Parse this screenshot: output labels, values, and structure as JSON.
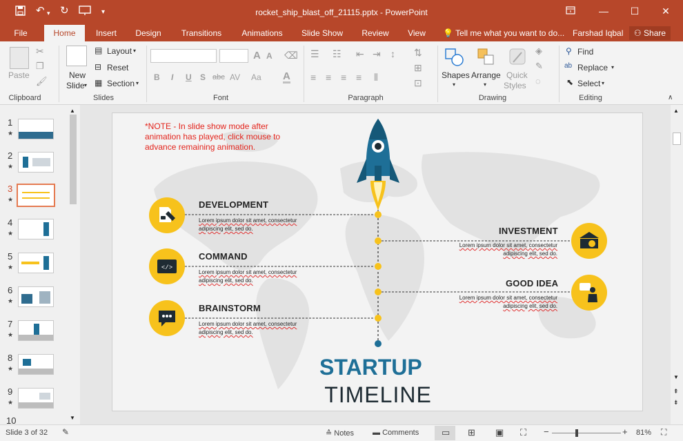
{
  "app": {
    "title": "rocket_ship_blast_off_21115.pptx - PowerPoint",
    "window_buttons": [
      "ribbon-display",
      "minimize",
      "maximize",
      "close"
    ]
  },
  "tabs": [
    {
      "label": "File"
    },
    {
      "label": "Home",
      "active": true
    },
    {
      "label": "Insert"
    },
    {
      "label": "Design"
    },
    {
      "label": "Transitions"
    },
    {
      "label": "Animations"
    },
    {
      "label": "Slide Show"
    },
    {
      "label": "Review"
    },
    {
      "label": "View"
    }
  ],
  "tell_me": "Tell me what you want to do...",
  "user": "Farshad Iqbal",
  "share": "Share",
  "ribbon": {
    "clipboard": {
      "paste": "Paste",
      "label": "Clipboard"
    },
    "slides": {
      "new_slide_1": "New",
      "new_slide_2": "Slide",
      "layout": "Layout",
      "reset": "Reset",
      "section": "Section",
      "label": "Slides"
    },
    "font": {
      "label": "Font",
      "bold": "B",
      "italic": "I",
      "underline": "U",
      "strike": "S",
      "strike2": "abc",
      "spacing": "AV",
      "case": "Aa",
      "grow": "A",
      "shrink": "A"
    },
    "paragraph": {
      "label": "Paragraph"
    },
    "drawing": {
      "shapes": "Shapes",
      "arrange": "Arrange",
      "quick_1": "Quick",
      "quick_2": "Styles",
      "label": "Drawing"
    },
    "editing": {
      "find": "Find",
      "replace": "Replace",
      "select": "Select",
      "label": "Editing"
    }
  },
  "thumbnails": [
    {
      "num": "1"
    },
    {
      "num": "2"
    },
    {
      "num": "3",
      "current": true
    },
    {
      "num": "4"
    },
    {
      "num": "5"
    },
    {
      "num": "6"
    },
    {
      "num": "7"
    },
    {
      "num": "8"
    },
    {
      "num": "9"
    },
    {
      "num": "10"
    }
  ],
  "slide": {
    "note": "*NOTE - In slide show mode after animation has played, click mouse to advance remaining animation.",
    "items": [
      {
        "title": "DEVELOPMENT",
        "desc1": "Lorem ipsum dolor sit amet, consectetur",
        "desc2": "adipiscing elit, sed do."
      },
      {
        "title": "COMMAND",
        "desc1": "Lorem ipsum dolor sit amet, consectetur",
        "desc2": "adipiscing elit, sed do."
      },
      {
        "title": "BRAINSTORM",
        "desc1": "Lorem ipsum dolor sit amet, consectetur",
        "desc2": "adipiscing elit, sed do."
      },
      {
        "title": "INVESTMENT",
        "desc1": "Lorem ipsum dolor sit amet, consectetur",
        "desc2": "adipiscing elit, sed do."
      },
      {
        "title": "GOOD IDEA",
        "desc1": "Lorem ipsum dolor sit amet, consectetur",
        "desc2": "adipiscing elit, sed do."
      }
    ],
    "heading_1": "STARTUP",
    "heading_2": "TIMELINE",
    "colors": {
      "yellow": "#f7c21c",
      "blue": "#1e6f97",
      "dark": "#1e2b33",
      "red": "#e3231b"
    }
  },
  "status": {
    "slide_info": "Slide 3 of 32",
    "notes": "Notes",
    "comments": "Comments",
    "zoom": "81%"
  }
}
